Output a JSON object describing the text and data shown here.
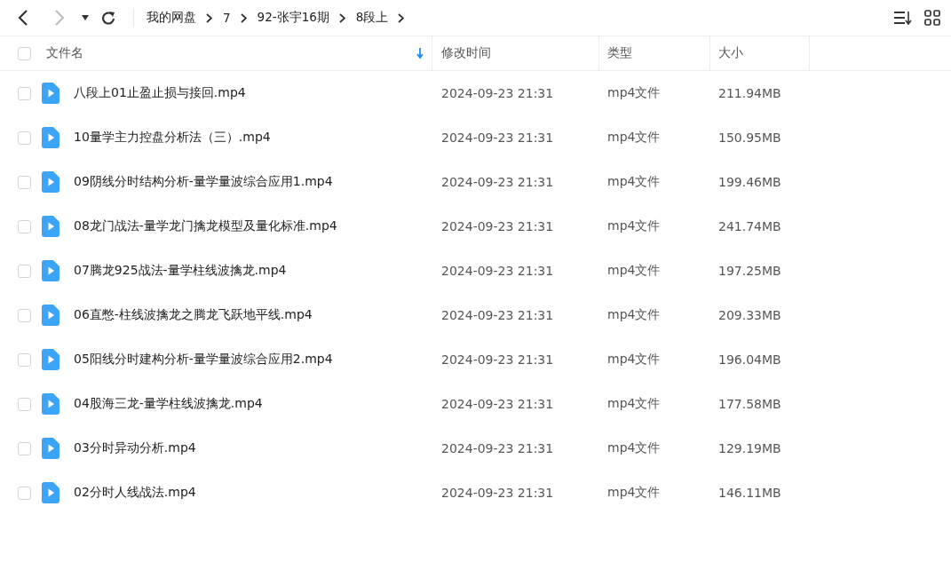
{
  "breadcrumb": [
    "我的网盘",
    "7",
    "92-张宇16期",
    "8段上"
  ],
  "table": {
    "all_checked": false,
    "columns": [
      "文件名",
      "修改时间",
      "类型",
      "大小"
    ],
    "rows": [
      {
        "name": "八段上01止盈止损与接回.mp4",
        "modified": "2024-09-23 21:31",
        "type": "mp4文件",
        "size": "211.94MB",
        "checked": false
      },
      {
        "name": "10量学主力控盘分析法（三）.mp4",
        "modified": "2024-09-23 21:31",
        "type": "mp4文件",
        "size": "150.95MB",
        "checked": false
      },
      {
        "name": "09阴线分时结构分析-量学量波综合应用1.mp4",
        "modified": "2024-09-23 21:31",
        "type": "mp4文件",
        "size": "199.46MB",
        "checked": false
      },
      {
        "name": "08龙门战法-量学龙门擒龙模型及量化标准.mp4",
        "modified": "2024-09-23 21:31",
        "type": "mp4文件",
        "size": "241.74MB",
        "checked": false
      },
      {
        "name": "07腾龙925战法-量学柱线波擒龙.mp4",
        "modified": "2024-09-23 21:31",
        "type": "mp4文件",
        "size": "197.25MB",
        "checked": false
      },
      {
        "name": "06直憋-柱线波擒龙之腾龙飞跃地平线.mp4",
        "modified": "2024-09-23 21:31",
        "type": "mp4文件",
        "size": "209.33MB",
        "checked": false
      },
      {
        "name": "05阳线分时建构分析-量学量波综合应用2.mp4",
        "modified": "2024-09-23 21:31",
        "type": "mp4文件",
        "size": "196.04MB",
        "checked": false
      },
      {
        "name": "04股海三龙-量学柱线波擒龙.mp4",
        "modified": "2024-09-23 21:31",
        "type": "mp4文件",
        "size": "177.58MB",
        "checked": false
      },
      {
        "name": "03分时异动分析.mp4",
        "modified": "2024-09-23 21:31",
        "type": "mp4文件",
        "size": "129.19MB",
        "checked": false
      },
      {
        "name": "02分时人线战法.mp4",
        "modified": "2024-09-23 21:31",
        "type": "mp4文件",
        "size": "146.11MB",
        "checked": false
      }
    ]
  }
}
